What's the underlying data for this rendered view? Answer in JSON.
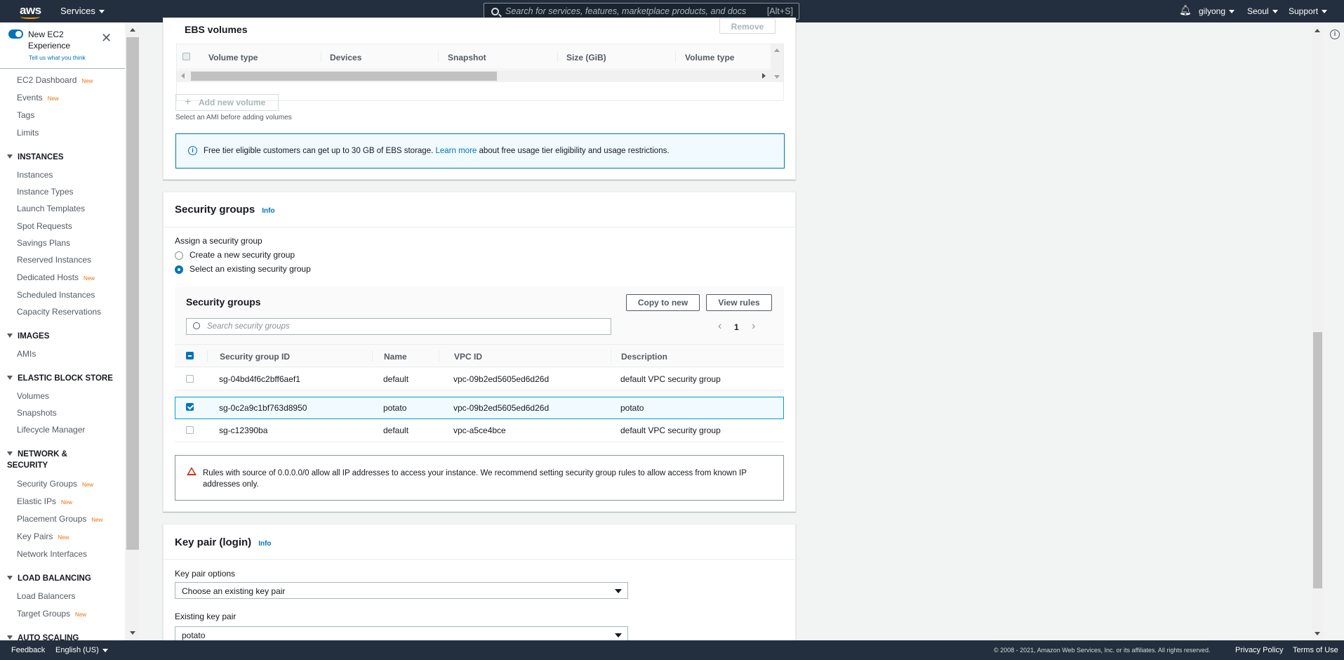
{
  "topnav": {
    "logo": "aws",
    "services": "Services",
    "search_placeholder": "Search for services, features, marketplace products, and docs",
    "search_shortcut": "[Alt+S]",
    "user": "gilyong",
    "region": "Seoul",
    "support": "Support"
  },
  "sidebar": {
    "new_experience": "New EC2 Experience",
    "tell_us": "Tell us what you think",
    "top_items": [
      {
        "label": "EC2 Dashboard",
        "badge": "New"
      },
      {
        "label": "Events",
        "badge": "New"
      },
      {
        "label": "Tags",
        "badge": ""
      },
      {
        "label": "Limits",
        "badge": ""
      }
    ],
    "sections": [
      {
        "title": "INSTANCES",
        "items": [
          {
            "label": "Instances",
            "badge": ""
          },
          {
            "label": "Instance Types",
            "badge": ""
          },
          {
            "label": "Launch Templates",
            "badge": ""
          },
          {
            "label": "Spot Requests",
            "badge": ""
          },
          {
            "label": "Savings Plans",
            "badge": ""
          },
          {
            "label": "Reserved Instances",
            "badge": ""
          },
          {
            "label": "Dedicated Hosts",
            "badge": "New"
          },
          {
            "label": "Scheduled Instances",
            "badge": ""
          },
          {
            "label": "Capacity Reservations",
            "badge": ""
          }
        ]
      },
      {
        "title": "IMAGES",
        "items": [
          {
            "label": "AMIs",
            "badge": ""
          }
        ]
      },
      {
        "title": "ELASTIC BLOCK STORE",
        "items": [
          {
            "label": "Volumes",
            "badge": ""
          },
          {
            "label": "Snapshots",
            "badge": ""
          },
          {
            "label": "Lifecycle Manager",
            "badge": ""
          }
        ]
      },
      {
        "title": "NETWORK & SECURITY",
        "items": [
          {
            "label": "Security Groups",
            "badge": "New"
          },
          {
            "label": "Elastic IPs",
            "badge": "New"
          },
          {
            "label": "Placement Groups",
            "badge": "New"
          },
          {
            "label": "Key Pairs",
            "badge": "New"
          },
          {
            "label": "Network Interfaces",
            "badge": ""
          }
        ]
      },
      {
        "title": "LOAD BALANCING",
        "items": [
          {
            "label": "Load Balancers",
            "badge": ""
          },
          {
            "label": "Target Groups",
            "badge": "New"
          }
        ]
      },
      {
        "title": "AUTO SCALING",
        "items": []
      }
    ]
  },
  "ebs": {
    "title": "EBS volumes",
    "remove": "Remove",
    "columns": [
      "Volume type",
      "Devices",
      "Snapshot",
      "Size (GiB)",
      "Volume type"
    ],
    "add_volume": "Add new volume",
    "hint": "Select an AMI before adding volumes",
    "alert_pre": "Free tier eligible customers can get up to 30 GB of EBS storage.",
    "alert_link": "Learn more",
    "alert_post": "about free usage tier eligibility and usage restrictions."
  },
  "security": {
    "title": "Security groups",
    "info": "Info",
    "assign_label": "Assign a security group",
    "option_create": "Create a new security group",
    "option_existing": "Select an existing security group",
    "table_title": "Security groups",
    "copy_button": "Copy to new",
    "view_button": "View rules",
    "search_placeholder": "Search security groups",
    "page": "1",
    "columns": [
      "Security group ID",
      "Name",
      "VPC ID",
      "Description"
    ],
    "rows": [
      {
        "id": "sg-04bd4f6c2bff6aef1",
        "name": "default",
        "vpc": "vpc-09b2ed5605ed6d26d",
        "desc": "default VPC security group",
        "selected": false
      },
      {
        "id": "sg-0c2a9c1bf763d8950",
        "name": "potato",
        "vpc": "vpc-09b2ed5605ed6d26d",
        "desc": "potato",
        "selected": true
      },
      {
        "id": "sg-c12390ba",
        "name": "default",
        "vpc": "vpc-a5ce4bce",
        "desc": "default VPC security group",
        "selected": false
      }
    ],
    "warning": "Rules with source of 0.0.0.0/0 allow all IP addresses to access your instance. We recommend setting security group rules to allow access from known IP addresses only."
  },
  "keypair": {
    "title": "Key pair (login)",
    "info": "Info",
    "options_label": "Key pair options",
    "options_value": "Choose an existing key pair",
    "existing_label": "Existing key pair",
    "existing_value": "potato"
  },
  "footer": {
    "feedback": "Feedback",
    "language": "English (US)",
    "copyright": "© 2008 - 2021, Amazon Web Services, Inc. or its affiliates. All rights reserved.",
    "privacy": "Privacy Policy",
    "terms": "Terms of Use"
  },
  "colors": {
    "nav": "#232f3e",
    "accent": "#0073bb",
    "orange": "#ec7211",
    "warning": "#d13212"
  }
}
